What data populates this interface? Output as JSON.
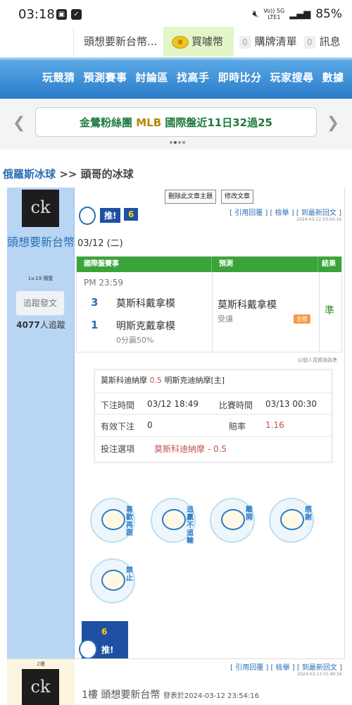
{
  "status_bar": {
    "time": "03:18",
    "signal_top": "Vo)) 5G",
    "signal_bottom": "LTE1",
    "battery": "85%"
  },
  "top_tabs": {
    "title": "頭想要新台幣...",
    "coin_label": "買噱幣",
    "coin_icon_text": "噱",
    "cart_count": "0",
    "cart_label": "購牌清單",
    "msg_count": "0",
    "msg_label": "訊息"
  },
  "nav": {
    "items": [
      "玩競猜",
      "預測賽事",
      "討論區",
      "找高手",
      "即時比分",
      "玩家搜尋",
      "數據"
    ]
  },
  "marquee": {
    "prefix": "金鶯粉絲團 ",
    "highlight": "MLB",
    "suffix": " 國際盤近11日32過25"
  },
  "breadcrumb": {
    "category": "俄羅斯冰球",
    "separator": " >> ",
    "thread": "頭哥的冰球"
  },
  "author": {
    "avatar_text": "ck",
    "name": "頭想要新台幣",
    "level": "Lv.19 隱聖",
    "follow_label": "追蹤發文",
    "follow_count": "4077",
    "follow_suffix": "人追蹤"
  },
  "post": {
    "delete_label": "刪除此文章主題",
    "edit_label": "修改文章",
    "links": "[ 引用回覆 ] [ 檢舉 ] [ 到最新回文 ]",
    "timestamp": "2024-03-12 23:54:16",
    "push_label": "推!",
    "push_count": "6",
    "date": "03/12 (二)"
  },
  "prediction": {
    "headers": [
      "國際盤賽事",
      "預測",
      "結果"
    ],
    "time": "PM 23:59",
    "teams": [
      {
        "score": "3",
        "name": "莫斯科戴拿模"
      },
      {
        "score": "1",
        "name": "明斯克戴拿模"
      }
    ],
    "handicap": "0分贏50%",
    "pick": "莫斯科戴拿模",
    "pick_sub": "受讓",
    "host_badge": "主推",
    "result": "準",
    "note": "以個人頁預測為準"
  },
  "bet": {
    "title_left": "莫斯科迪納摩 ",
    "title_value": "0.5",
    "title_right": " 明斯克迪納摩[主]",
    "order_time_label": "下注時間",
    "order_time": "03/12 18:49",
    "match_time_label": "比賽時間",
    "match_time": "03/13 00:30",
    "valid_label": "有效下注",
    "valid": "0",
    "odds_label": "賠率",
    "odds": "1.16",
    "option_label": "投注選項",
    "option": "莫斯科迪納摩 - 0.5"
  },
  "stickers": [
    {
      "name": "sticker-like-more",
      "text": "喜歡再跟"
    },
    {
      "name": "sticker-chase",
      "text": "追贏不追輸"
    },
    {
      "name": "sticker-leave",
      "text": "離開"
    },
    {
      "name": "sticker-thanks",
      "text": "感謝"
    },
    {
      "name": "sticker-no-wander",
      "text": "禁止"
    }
  ],
  "push2": {
    "count": "6",
    "label": "推!"
  },
  "reply": {
    "floor": "2樓",
    "avatar_text": "ck",
    "links": "[ 引用回覆 ] [ 檢舉 ] [ 到最新回文 ]",
    "timestamp": "2024-03-13 01:40:56",
    "floor_label": "1樓",
    "author": "頭想要新台幣",
    "posted_label": "發表於2024-03-12 23:54:16"
  },
  "colors": {
    "nav_blue": "#2a7cc9",
    "green_header": "#3aa43a",
    "odds_red": "#c45050",
    "sidebar_blue": "#b8d6f4"
  }
}
